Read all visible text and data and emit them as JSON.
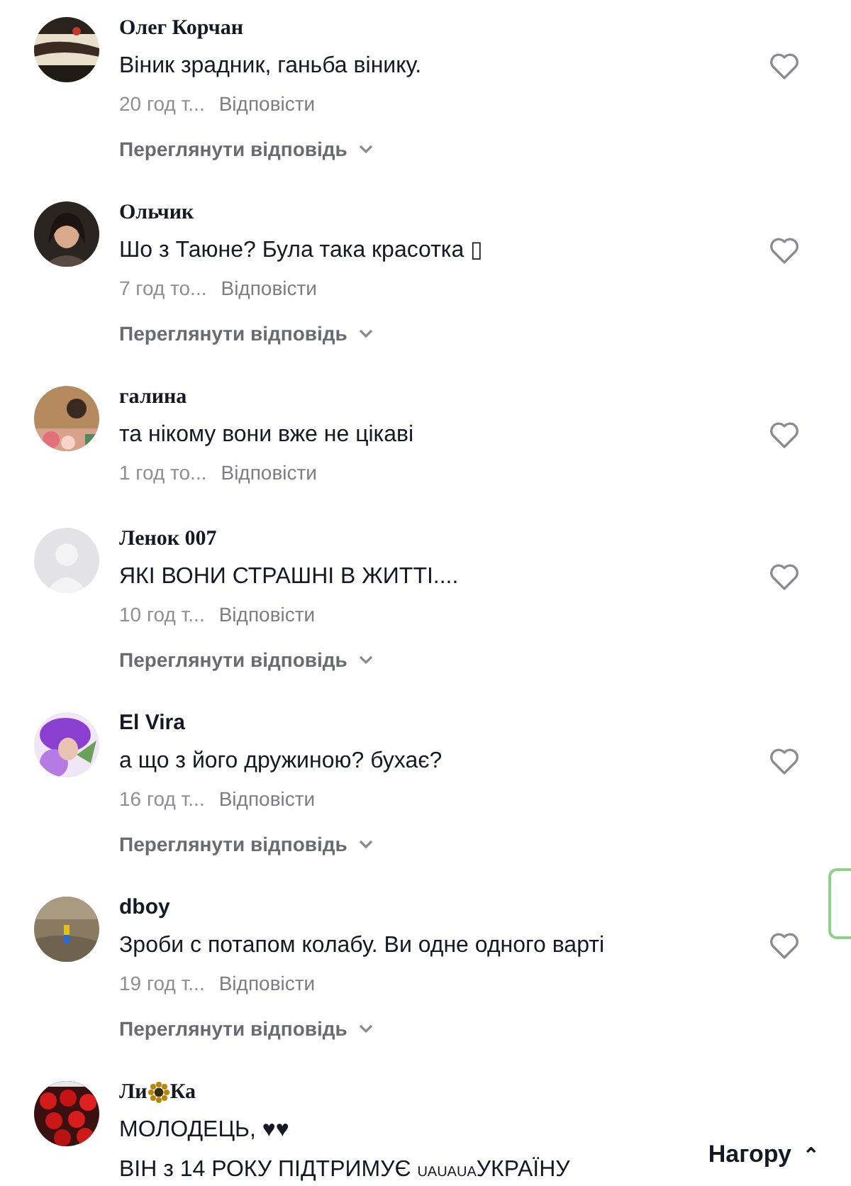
{
  "comments": [
    {
      "avatar": {
        "kind": "picture"
      },
      "name": [
        {
          "text": "Олег Корчан",
          "kind": "serif"
        }
      ],
      "lines": [
        [
          {
            "text": "Віник зрадник, ганьба вінику.",
            "kind": "text"
          }
        ]
      ],
      "time": "20 год т...",
      "reply": "Відповісти",
      "liked": false,
      "view_replies": "Переглянути відповідь"
    },
    {
      "avatar": {
        "kind": "picture"
      },
      "name": [
        {
          "text": "Ольчик",
          "kind": "serif"
        }
      ],
      "lines": [
        [
          {
            "text": "Шо з Таюне? Була така красотка ▯",
            "kind": "text"
          }
        ]
      ],
      "time": "7 год то...",
      "reply": "Відповісти",
      "liked": false,
      "view_replies": "Переглянути відповідь"
    },
    {
      "avatar": {
        "kind": "picture"
      },
      "name": [
        {
          "text": "галина",
          "kind": "serif"
        }
      ],
      "lines": [
        [
          {
            "text": "та нікому вони вже не цікаві",
            "kind": "text"
          }
        ]
      ],
      "time": "1 год то...",
      "reply": "Відповісти",
      "liked": false
    },
    {
      "avatar": {
        "kind": "default"
      },
      "name": [
        {
          "text": "Ленок 007",
          "kind": "serif"
        }
      ],
      "lines": [
        [
          {
            "text": "ЯКІ ВОНИ СТРАШНІ В ЖИТТІ....",
            "kind": "text"
          }
        ]
      ],
      "time": "10 год т...",
      "reply": "Відповісти",
      "liked": false,
      "view_replies": "Переглянути відповідь"
    },
    {
      "avatar": {
        "kind": "picture"
      },
      "name": [
        {
          "text": "El Vira",
          "kind": "sans"
        }
      ],
      "lines": [
        [
          {
            "text": "а що з його дружиною? бухає?",
            "kind": "text"
          }
        ]
      ],
      "time": "16 год т...",
      "reply": "Відповісти",
      "liked": false,
      "view_replies": "Переглянути відповідь"
    },
    {
      "avatar": {
        "kind": "picture"
      },
      "name": [
        {
          "text": "dboy",
          "kind": "sans"
        }
      ],
      "lines": [
        [
          {
            "text": "Зроби с потапом колабу. Ви одне одного варті",
            "kind": "text"
          }
        ]
      ],
      "time": "19 год т...",
      "reply": "Відповісти",
      "liked": false,
      "view_replies": "Переглянути відповідь"
    },
    {
      "avatar": {
        "kind": "picture"
      },
      "name": [
        {
          "text": "Ли",
          "kind": "serif"
        },
        {
          "kind": "flower"
        },
        {
          "text": "Ка",
          "kind": "serif"
        }
      ],
      "lines": [
        [
          {
            "text": "МОЛОДЕЦЬ, ♥♥",
            "kind": "text"
          }
        ],
        [
          {
            "text": "ВІН з 14 РОКУ ПІДТРИМУЄ ",
            "kind": "text"
          },
          {
            "text": "UAUAUA",
            "kind": "small"
          },
          {
            "text": "УКРАЇНУ",
            "kind": "text"
          }
        ]
      ]
    }
  ],
  "back_to_top": {
    "label": "Нагору",
    "icon": "⌃"
  }
}
